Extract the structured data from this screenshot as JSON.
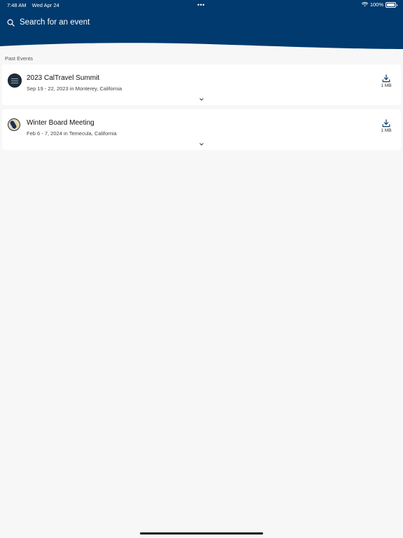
{
  "status_bar": {
    "time": "7:48 AM",
    "date": "Wed Apr 24",
    "dots": "•••",
    "battery_text": "100%"
  },
  "header": {
    "background_color": "#003a6e",
    "search": {
      "placeholder": "Search for an event",
      "icon": "search-icon"
    }
  },
  "section": {
    "label": "Past Events"
  },
  "events": [
    {
      "title": "2023 CalTravel Summit",
      "details": "Sep 19 - 22, 2023 in Monterey, California",
      "download_size": "1 MB",
      "logo_icon": "caltravel-logo"
    },
    {
      "title": "Winter Board Meeting",
      "details": "Feb 6 - 7, 2024 in Temecula, California",
      "download_size": "1 MB",
      "logo_icon": "california-logo"
    }
  ]
}
